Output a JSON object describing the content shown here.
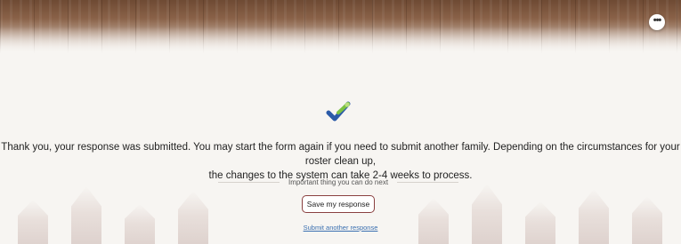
{
  "header": {
    "more_icon": "more-dots-icon",
    "more_glyph": "•••"
  },
  "confirmation": {
    "check_icon": "checkmark-icon",
    "check_colors": {
      "blue": "#2b5aa8",
      "green": "#7cc242"
    },
    "message_line1": "Thank you, your response was submitted. You may start the form again if you need to submit another family.  Depending on the circumstances for your roster clean up,",
    "message_line2": "the changes to the system can take 2-4 weeks to process."
  },
  "next_steps": {
    "heading": "Important thing you can do next",
    "save_label": "Save my response",
    "submit_another_label": "Submit another response"
  },
  "colors": {
    "accent_link": "#3a6fb0",
    "button_border": "#8a4040"
  }
}
